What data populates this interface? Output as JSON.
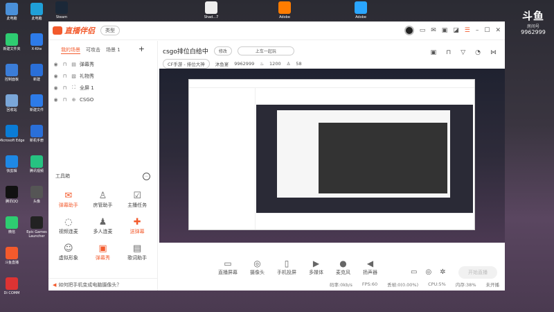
{
  "desktop": {
    "brand": {
      "logo": "斗鱼",
      "label": "房间号",
      "room_number": "9962999"
    },
    "icons_left": [
      {
        "label": "此电脑",
        "color": "#4a90d9"
      },
      {
        "label": "新建文件夹",
        "color": "#2ecc71"
      },
      {
        "label": "控制面板",
        "color": "#3b7dd8"
      },
      {
        "label": "回收站",
        "color": "#7aa6d8"
      },
      {
        "label": "Microsoft Edge",
        "color": "#0a7cd6"
      },
      {
        "label": "快剪辑",
        "color": "#1e88e5"
      },
      {
        "label": "腾讯QQ",
        "color": "#111"
      },
      {
        "label": "微信",
        "color": "#2ecc71"
      },
      {
        "label": "斗鱼直播",
        "color": "#f35a2c"
      },
      {
        "label": "Di COMM",
        "color": "#d33"
      }
    ],
    "icons_right": [
      {
        "label": "此电脑",
        "color": "#1fa0d8"
      },
      {
        "label": "X-Kite",
        "color": "#2d7be8"
      },
      {
        "label": "新建",
        "color": "#2a6fd8"
      },
      {
        "label": "新建文件",
        "color": "#2d7be8"
      },
      {
        "label": "新机手册",
        "color": "#2a6fd8"
      },
      {
        "label": "腾讯视频",
        "color": "#26c281"
      },
      {
        "label": "头像",
        "color": "#555"
      },
      {
        "label": "Epic Games Launcher",
        "color": "#222"
      }
    ],
    "icons_top": [
      {
        "label": "Steam",
        "color": "#1b2838"
      },
      {
        "label": "Shad...7",
        "color": "#eee"
      },
      {
        "label": "Adobe",
        "color": "#ff7c00"
      },
      {
        "label": "Adobe",
        "color": "#2aa6ff"
      }
    ]
  },
  "app": {
    "name": "直播伴侣",
    "type_button": "类型",
    "left": {
      "tabs": [
        "我的场景",
        "可攻击",
        "场景 1"
      ],
      "active_tab": 0,
      "sources": [
        {
          "name": "弹幕秀",
          "icon": "ticket-icon"
        },
        {
          "name": "礼物秀",
          "icon": "gift-icon"
        },
        {
          "name": "全屏 1",
          "icon": "fullscreen-icon"
        },
        {
          "name": "CSGO",
          "icon": "game-icon"
        }
      ],
      "tools_title": "工具箱",
      "tools": [
        {
          "label": "弹幕助手",
          "icon": "chat-icon",
          "highlight": true
        },
        {
          "label": "房管助手",
          "icon": "user-icon",
          "highlight": false
        },
        {
          "label": "主播任务",
          "icon": "task-icon",
          "highlight": false
        },
        {
          "label": "视频连麦",
          "icon": "video-icon",
          "highlight": false
        },
        {
          "label": "多人连麦",
          "icon": "group-icon",
          "highlight": false
        },
        {
          "label": "送弹幕",
          "icon": "send-icon",
          "highlight": true
        },
        {
          "label": "虚拟形象",
          "icon": "avatar-icon",
          "highlight": false
        },
        {
          "label": "弹幕秀",
          "icon": "barrage-icon",
          "highlight": true
        },
        {
          "label": "歌词助手",
          "icon": "lyric-icon",
          "highlight": false
        }
      ],
      "tip": "如何把手机变成电脑摄像头？"
    },
    "room": {
      "title": "csgo排位白给中",
      "edit_button": "修改",
      "slogan_button": "上车一起玩",
      "category": "CF手游 - 排位大神",
      "fans_label": "沐鱼宴",
      "room_id": "9962999",
      "hot": "1200",
      "viewers": "58"
    },
    "controls": [
      {
        "label": "直播屏幕",
        "icon": "screen-icon"
      },
      {
        "label": "摄像头",
        "icon": "camera-icon"
      },
      {
        "label": "手机投屏",
        "icon": "phone-icon"
      },
      {
        "label": "多媒体",
        "icon": "media-icon"
      },
      {
        "label": "麦克风",
        "icon": "mic-icon"
      },
      {
        "label": "扬声器",
        "icon": "speaker-icon"
      }
    ],
    "go_live_label": "开始直播",
    "status": [
      "码率:0kb/s",
      "FPS:60",
      "丢帧:0(0.00%)",
      "CPU:5%",
      "内存:38%",
      "未开播"
    ]
  }
}
